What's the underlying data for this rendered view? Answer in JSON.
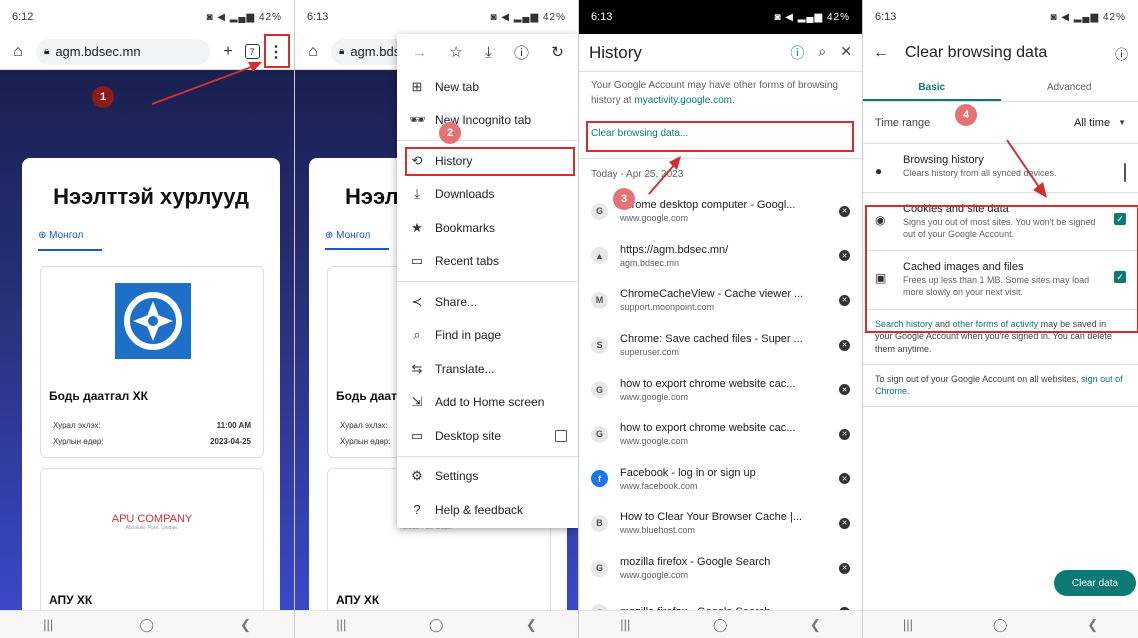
{
  "status_bar": {
    "time1": "6:12",
    "time2": "6:13",
    "time3": "6:13",
    "time4": "6:13",
    "battery": "42%"
  },
  "browser": {
    "url": "agm.bdsec.mn",
    "url_short": "agm.bdsec",
    "tab_count": "7"
  },
  "site": {
    "heading": "Нээлттэй хурлууд",
    "heading_short": "Нээлт",
    "lang": "Монгол",
    "lang_short": "Монгол",
    "card1": {
      "name": "Бодь даатгал ХК",
      "name_short": "Бодь даатг",
      "start_label": "Хурал эхлэх:",
      "start_value": "11:00 AM",
      "date_label": "Хурлын өдөр:",
      "date_value": "2023-04-25"
    },
    "card2": {
      "logo_text": "APU COMPANY",
      "logo_sub": "Absolute. Pure. Unique.",
      "name": "АПУ ХК"
    }
  },
  "menu": {
    "items": [
      {
        "icon": "new-tab-icon",
        "glyph": "⊞",
        "label": "New tab"
      },
      {
        "icon": "incognito-icon",
        "glyph": "🕶",
        "label": "New Incognito tab"
      },
      {
        "icon": "history-icon",
        "glyph": "⟲",
        "label": "History"
      },
      {
        "icon": "downloads-icon",
        "glyph": "⤓",
        "label": "Downloads"
      },
      {
        "icon": "bookmarks-icon",
        "glyph": "★",
        "label": "Bookmarks"
      },
      {
        "icon": "recent-tabs-icon",
        "glyph": "▭",
        "label": "Recent tabs"
      },
      {
        "icon": "share-icon",
        "glyph": "≺",
        "label": "Share..."
      },
      {
        "icon": "find-icon",
        "glyph": "⌕",
        "label": "Find in page"
      },
      {
        "icon": "translate-icon",
        "glyph": "⇆",
        "label": "Translate..."
      },
      {
        "icon": "add-home-icon",
        "glyph": "⇲",
        "label": "Add to Home screen"
      },
      {
        "icon": "desktop-icon",
        "glyph": "▭",
        "label": "Desktop site"
      },
      {
        "icon": "settings-icon",
        "glyph": "⚙",
        "label": "Settings"
      },
      {
        "icon": "help-icon",
        "glyph": "?",
        "label": "Help & feedback"
      }
    ]
  },
  "history": {
    "title": "History",
    "note_pre": "Your Google Account may have other forms of browsing history at ",
    "note_link": "myactivity.google.com",
    "note_post": ".",
    "clear_link": "Clear browsing data...",
    "date_header": "Today - Apr 25, 2023",
    "rows": [
      {
        "fav": "G",
        "title": "chrome desktop computer - Googl...",
        "url": "www.google.com"
      },
      {
        "fav": "▲",
        "title": "https://agm.bdsec.mn/",
        "url": "agm.bdsec.mn"
      },
      {
        "fav": "M",
        "title": "ChromeCacheView - Cache viewer ...",
        "url": "support.moonpoint.com"
      },
      {
        "fav": "S",
        "title": "Chrome: Save cached files - Super ...",
        "url": "superuser.com"
      },
      {
        "fav": "G",
        "title": "how to export chrome website cac...",
        "url": "www.google.com"
      },
      {
        "fav": "G",
        "title": "how to export chrome website cac...",
        "url": "www.google.com"
      },
      {
        "fav": "f",
        "title": "Facebook - log in or sign up",
        "url": "www.facebook.com"
      },
      {
        "fav": "B",
        "title": "How to Clear Your Browser Cache |...",
        "url": "www.bluehost.com"
      },
      {
        "fav": "G",
        "title": "mozilla firefox - Google Search",
        "url": "www.google.com"
      },
      {
        "fav": "G",
        "title": "mozilla firefox - Google Search",
        "url": ""
      }
    ]
  },
  "cbd": {
    "title": "Clear browsing data",
    "tab_basic": "Basic",
    "tab_advanced": "Advanced",
    "time_range_label": "Time range",
    "time_range_value": "All time",
    "options": [
      {
        "icon": "clock-icon",
        "glyph": "●",
        "title": "Browsing history",
        "desc": "Clears history from all synced devices.",
        "checked": false
      },
      {
        "icon": "cookie-icon",
        "glyph": "◉",
        "title": "Cookies and site data",
        "desc": "Signs you out of most sites. You won't be signed out of your Google Account.",
        "checked": true
      },
      {
        "icon": "image-icon",
        "glyph": "▣",
        "title": "Cached images and files",
        "desc": "Frees up less than 1 MB. Some sites may load more slowly on your next visit.",
        "checked": true
      }
    ],
    "footer1_link1": "Search history",
    "footer1_mid": " and ",
    "footer1_link2": "other forms of activity",
    "footer1_post": " may be saved in your Google Account when you're signed in. You can delete them anytime.",
    "footer2_pre": "To sign out of your Google Account on all websites, ",
    "footer2_link": "sign out of Chrome",
    "footer2_post": ".",
    "clear_button": "Clear data"
  },
  "steps": [
    "1",
    "2",
    "3",
    "4"
  ],
  "colors": {
    "step_badge": "#b3261e",
    "annotation": "#d32f2f",
    "accent": "#0b7a75"
  }
}
